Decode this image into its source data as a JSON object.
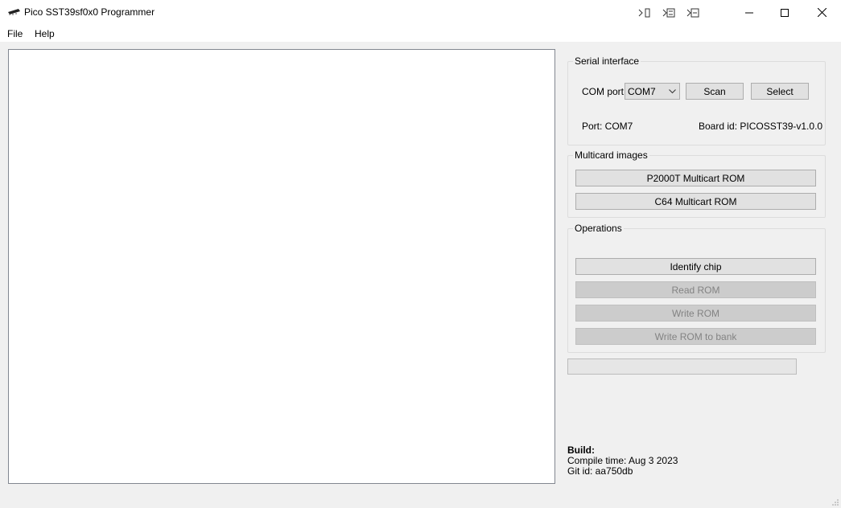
{
  "window": {
    "title": "Pico SST39sf0x0 Programmer"
  },
  "titlebar_tools": [
    "step-into-icon",
    "step-over-icon",
    "step-out-icon"
  ],
  "menu": {
    "file": "File",
    "help": "Help"
  },
  "serial": {
    "group_title": "Serial interface",
    "com_port_label": "COM port",
    "com_port_value": "COM7",
    "scan_label": "Scan",
    "select_label": "Select",
    "port_status": "Port: COM7",
    "board_id": "Board id: PICOSST39-v1.0.0"
  },
  "multicard": {
    "group_title": "Multicard images",
    "p2000t": "P2000T Multicart ROM",
    "c64": "C64 Multicart ROM"
  },
  "operations": {
    "group_title": "Operations",
    "identify": "Identify chip",
    "read": "Read ROM",
    "write": "Write ROM",
    "write_bank": "Write ROM to bank"
  },
  "progress": 0,
  "build": {
    "heading": "Build:",
    "compile_time": "Compile time: Aug 3 2023",
    "git_id": "Git id: aa750db"
  }
}
